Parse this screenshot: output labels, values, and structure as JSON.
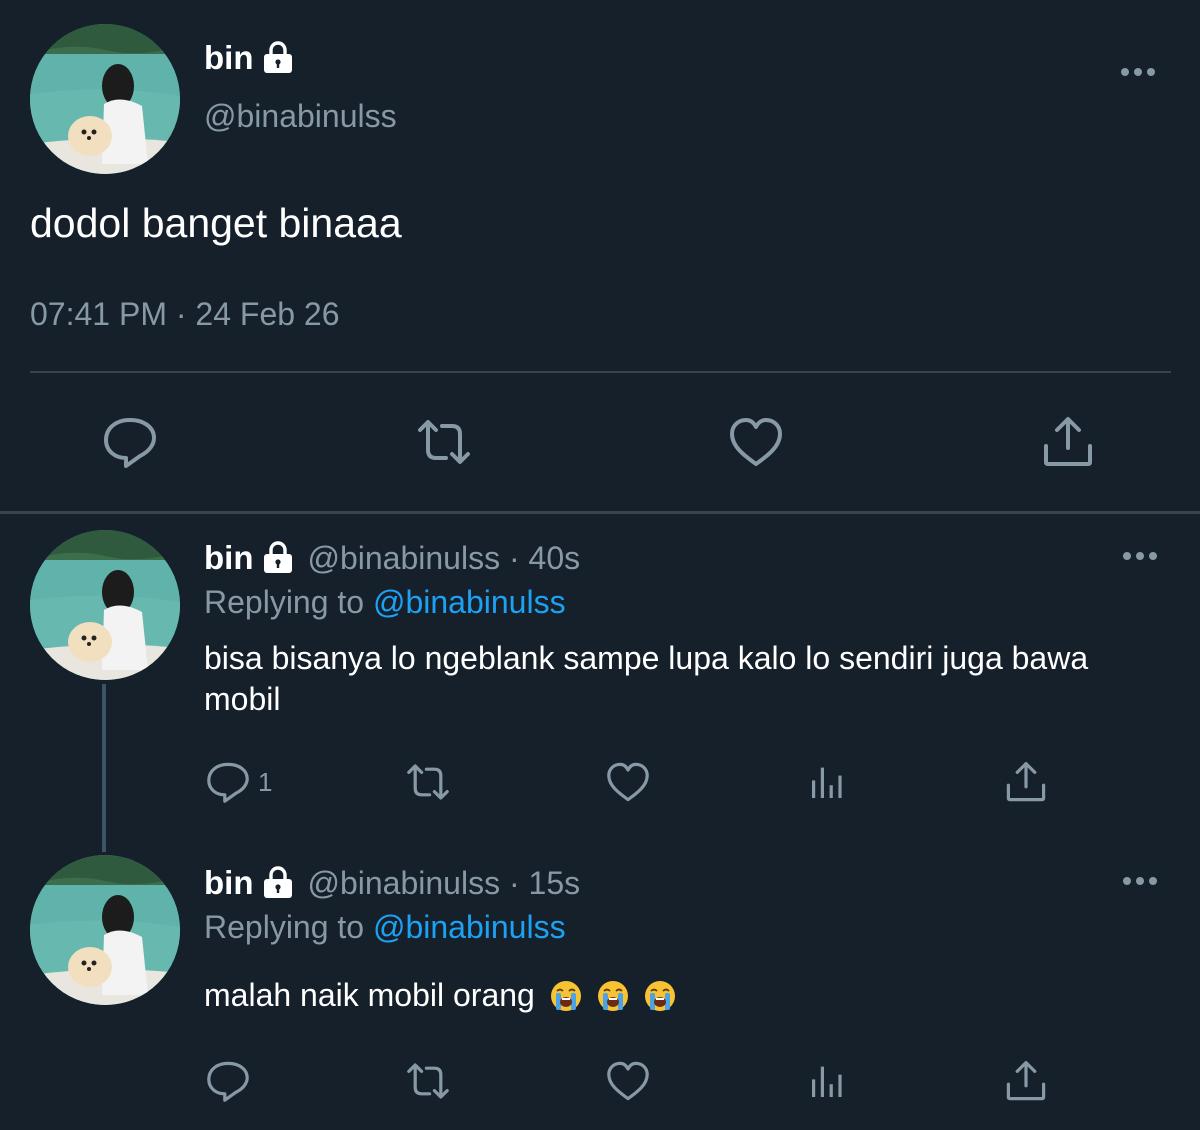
{
  "main_tweet": {
    "display_name": "bin",
    "handle": "@binabinulss",
    "text": "dodol banget binaaa",
    "timestamp": "07:41 PM · 24 Feb 26",
    "actions": [
      "reply-icon",
      "retweet-icon",
      "like-icon",
      "share-icon"
    ]
  },
  "replies": [
    {
      "display_name": "bin",
      "meta": "@binabinulss · 40s",
      "replying_prefix": "Replying to",
      "replying_mention": "@binabinulss",
      "text": "bisa bisanya lo ngeblank sampe lupa kalo lo sendiri juga bawa mobil",
      "reply_count": "1",
      "actions": [
        "reply-icon",
        "retweet-icon",
        "like-icon",
        "analytics-icon",
        "share-icon"
      ]
    },
    {
      "display_name": "bin",
      "meta": "@binabinulss · 15s",
      "replying_prefix": "Replying to",
      "replying_mention": "@binabinulss",
      "text": "malah naik mobil orang",
      "emoji": [
        "loudly-crying-face",
        "loudly-crying-face",
        "loudly-crying-face"
      ],
      "reply_count": "",
      "actions": [
        "reply-icon",
        "retweet-icon",
        "like-icon",
        "analytics-icon",
        "share-icon"
      ]
    }
  ],
  "colors": {
    "background": "#15202b",
    "divider": "#38444d",
    "secondary_text": "#8899a6",
    "mention": "#1da1f2",
    "thread_line": "#3d5466"
  }
}
